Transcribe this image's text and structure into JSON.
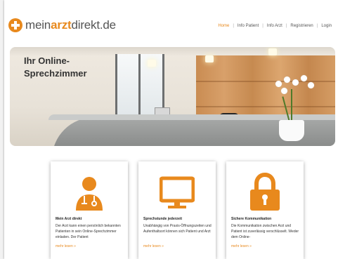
{
  "brand": {
    "logo_prefix": "mein",
    "logo_highlight": "arzt",
    "logo_suffix": "direkt.de",
    "accent_color": "#e8891d"
  },
  "nav": {
    "items": [
      {
        "label": "Home",
        "active": true
      },
      {
        "label": "Info Patient",
        "active": false
      },
      {
        "label": "Info Arzt",
        "active": false
      },
      {
        "label": "Registrieren",
        "active": false
      },
      {
        "label": "Login",
        "active": false
      }
    ],
    "separator": "|"
  },
  "hero": {
    "title_line1": "Ihr Online-",
    "title_line2": "Sprechzimmer"
  },
  "cards": [
    {
      "icon": "doctor-icon",
      "title": "Mein Arzt direkt",
      "text": "Der Arzt kann einen persönlich bekannten Patienten in sein Online-Sprechzimmer einladen. Der Patient",
      "more": "mehr lesen »"
    },
    {
      "icon": "monitor-icon",
      "title": "Sprechstunde jederzeit",
      "text": "Unabhängig von Praxis-Öffnungszeiten und Aufenthaltsort können sich Patient und Arzt",
      "more": "mehr lesen »"
    },
    {
      "icon": "lock-icon",
      "title": "Sichere Kommunikation",
      "text": "Die Kommunikation zwischen Arzt und Patient ist zuverlässig verschlüsselt. Weder dem Online-",
      "more": "mehr lesen »"
    }
  ]
}
